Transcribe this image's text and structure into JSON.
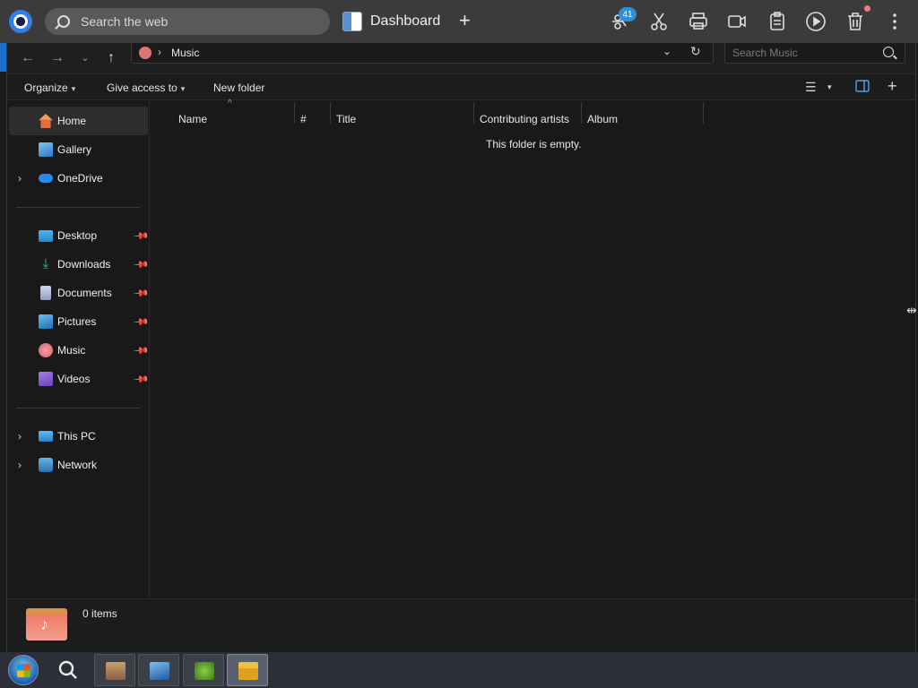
{
  "browser": {
    "search_placeholder": "Search the web",
    "tab_title": "Dashboard",
    "new_tab_label": "+",
    "notification_count": "41"
  },
  "explorer": {
    "breadcrumb": {
      "separator": "›",
      "folder": "Music"
    },
    "search_placeholder": "Search Music",
    "commands": {
      "organize": "Organize",
      "give_access": "Give access to",
      "new_folder": "New folder"
    },
    "nav": {
      "home": "Home",
      "gallery": "Gallery",
      "onedrive": "OneDrive",
      "desktop": "Desktop",
      "downloads": "Downloads",
      "documents": "Documents",
      "pictures": "Pictures",
      "music": "Music",
      "videos": "Videos",
      "this_pc": "This PC",
      "network": "Network"
    },
    "columns": [
      "Name",
      "#",
      "Title",
      "Contributing artists",
      "Album"
    ],
    "empty_message": "This folder is empty.",
    "item_count": "0 items"
  },
  "colors": {
    "accent": "#1e6fd0",
    "badge": "#2b8fe0"
  }
}
